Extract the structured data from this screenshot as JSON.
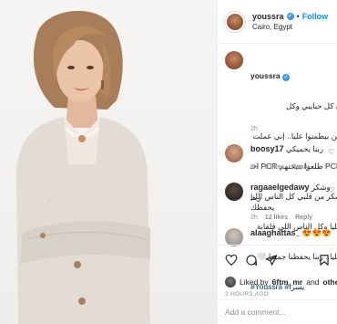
{
  "header": {
    "username": "youssra",
    "follow_label": "Follow",
    "dot": "•",
    "location": "Cairo, Egypt"
  },
  "caption": {
    "username": "youssra",
    "text_lines": [
      "ن كل حبايبي وكل",
      "نين بيطمنوا عليا.. إني عملت 2",
      "PCR طلعوا نتيجتهم PCR اختبار",
      "شكر من قلبي كل الناس اللي",
      "عليا وكل الناس اللي قلقانة",
      "عليا.. ربنا يحفظنا جميعا 🤍"
    ],
    "hashtag": "#Youssra #يسرا",
    "time": "2h"
  },
  "comments": [
    {
      "username": "boosy17",
      "text": "ربنا يحميكي",
      "time": "1h",
      "likes": "8 likes",
      "reply": "Reply"
    },
    {
      "username": "ragaaelgedawy",
      "text": "وشكر ربنا",
      "text2": "يحفظك",
      "time": "2h",
      "likes": "12 likes",
      "reply": "Reply"
    },
    {
      "username": "alaaghattas_",
      "text": "😍😍😍"
    }
  ],
  "actions": {
    "liked_by_prefix": "Liked by",
    "liked_by_user": "6ftm_mr",
    "liked_by_and": "and",
    "liked_by_others": "others",
    "timestamp": "2 HOURS AGO"
  },
  "add_comment": {
    "placeholder": "Add a comment..."
  },
  "colors": {
    "link_blue": "#0095f6",
    "verified_blue": "#3897f0",
    "muted": "#8e8e8e",
    "text": "#262626",
    "border": "#efefef"
  }
}
